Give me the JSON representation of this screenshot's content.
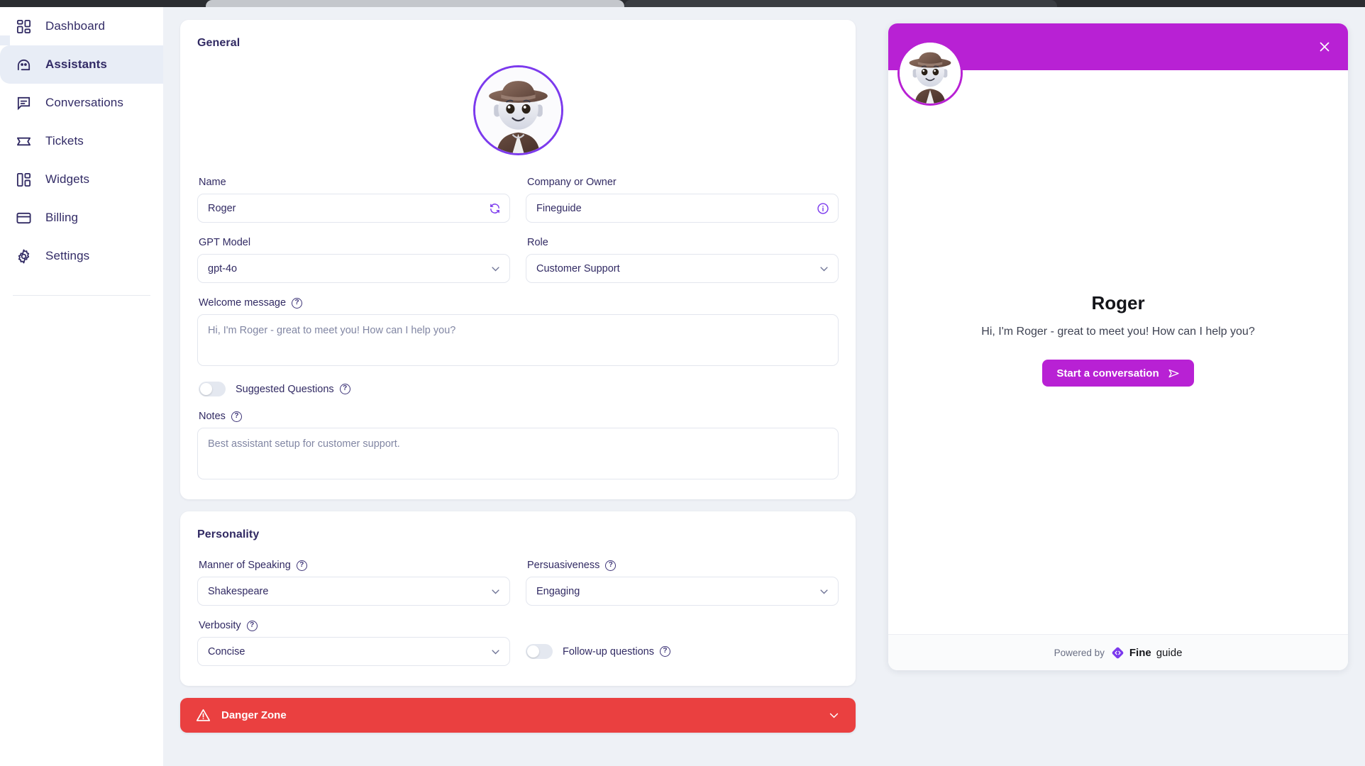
{
  "sidebar": {
    "items": [
      {
        "label": "Dashboard",
        "icon": "dashboard-icon",
        "active": false
      },
      {
        "label": "Assistants",
        "icon": "assistants-icon",
        "active": true
      },
      {
        "label": "Conversations",
        "icon": "conversations-icon",
        "active": false
      },
      {
        "label": "Tickets",
        "icon": "ticket-icon",
        "active": false
      },
      {
        "label": "Widgets",
        "icon": "widgets-icon",
        "active": false
      },
      {
        "label": "Billing",
        "icon": "billing-icon",
        "active": false
      },
      {
        "label": "Settings",
        "icon": "gear-icon",
        "active": false
      }
    ]
  },
  "general": {
    "title": "General",
    "avatar_alt": "robot-with-hat-avatar",
    "name": {
      "label": "Name",
      "value": "Roger",
      "action_icon": "refresh-icon"
    },
    "company": {
      "label": "Company or Owner",
      "value": "Fineguide",
      "action_icon": "info-icon"
    },
    "gpt_model": {
      "label": "GPT Model",
      "value": "gpt-4o"
    },
    "role": {
      "label": "Role",
      "value": "Customer Support"
    },
    "welcome_message": {
      "label": "Welcome message",
      "placeholder": "Hi, I'm Roger - great to meet you! How can I help you?"
    },
    "suggested_questions": {
      "label": "Suggested Questions",
      "enabled": false
    },
    "notes": {
      "label": "Notes",
      "placeholder": "Best assistant setup for customer support."
    }
  },
  "personality": {
    "title": "Personality",
    "manner_of_speaking": {
      "label": "Manner of Speaking",
      "value": "Shakespeare"
    },
    "persuasiveness": {
      "label": "Persuasiveness",
      "value": "Engaging"
    },
    "verbosity": {
      "label": "Verbosity",
      "value": "Concise"
    },
    "follow_up_questions": {
      "label": "Follow-up questions",
      "enabled": false
    }
  },
  "danger_zone": {
    "title": "Danger Zone",
    "expanded": false
  },
  "widget_preview": {
    "assistant_name": "Roger",
    "greeting": "Hi, I'm Roger - great to meet you! How can I help you?",
    "cta_label": "Start a conversation",
    "powered_by": "Powered by",
    "brand_bold": "Fine",
    "brand_light": "guide",
    "header_color": "#b821d4"
  },
  "colors": {
    "accent_purple": "#7c3aed",
    "widget_magenta": "#b821d4",
    "danger_red": "#ea4040",
    "nav_text": "#312a63",
    "page_bg": "#eef1f6"
  }
}
